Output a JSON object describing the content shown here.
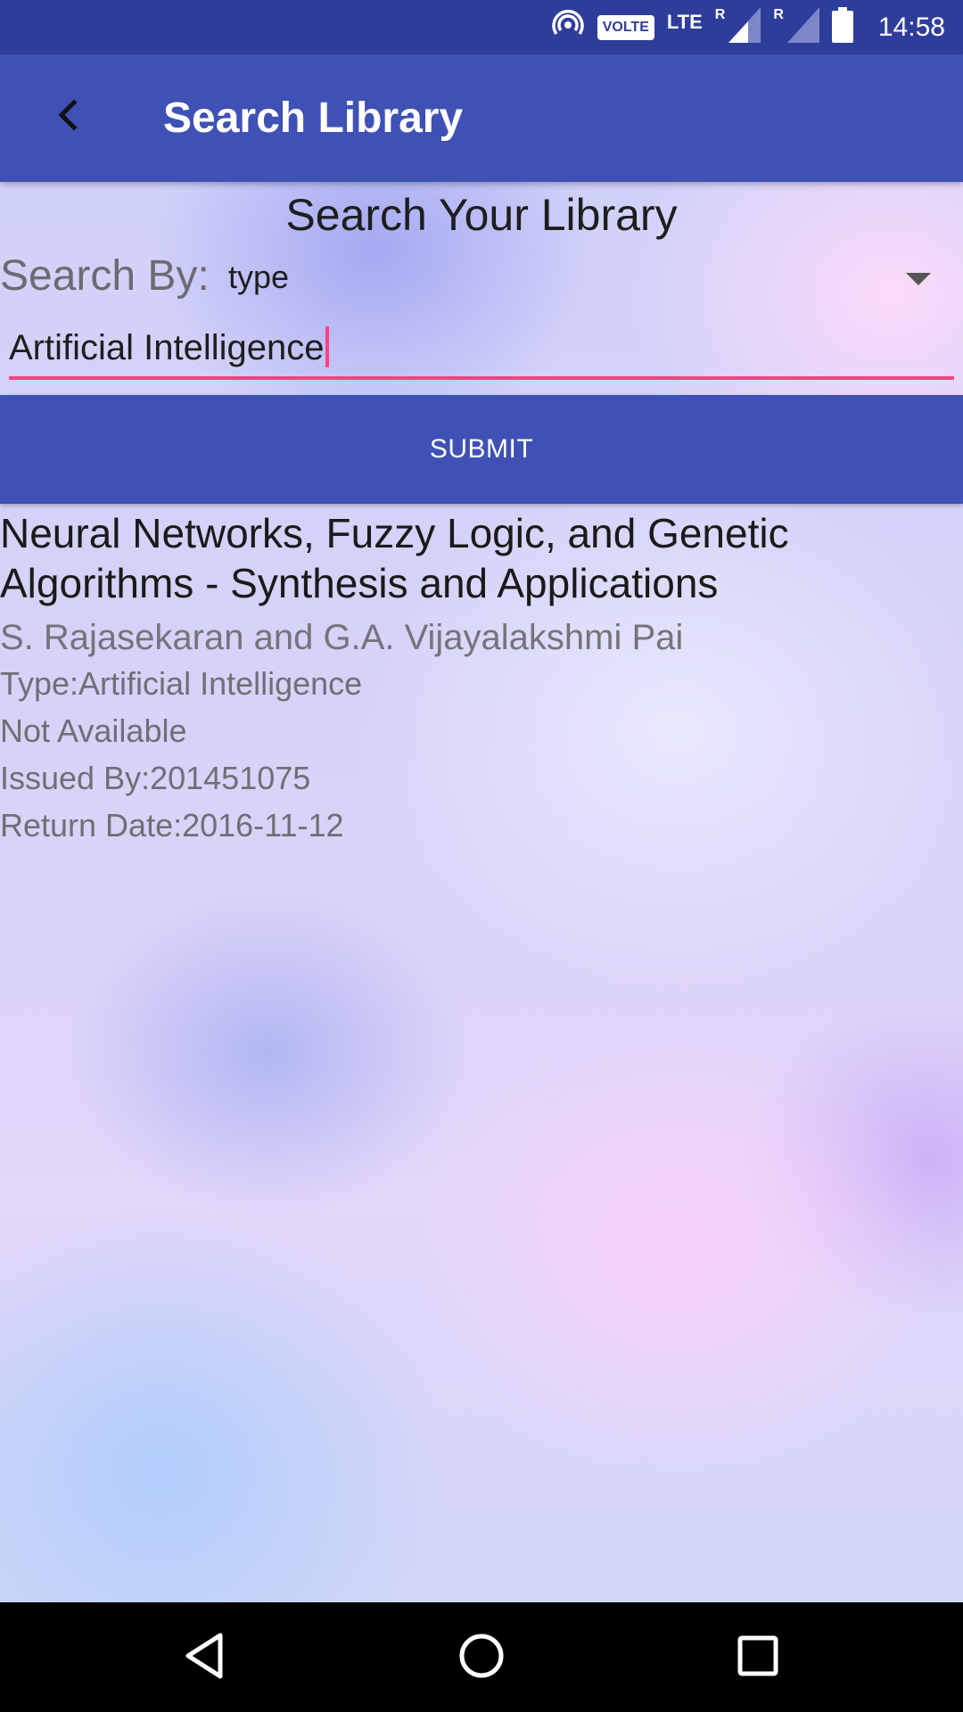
{
  "status_bar": {
    "volte": "VOLTE",
    "lte": "LTE",
    "roaming_1": "R",
    "roaming_2": "R",
    "time": "14:58"
  },
  "app_bar": {
    "title": "Search Library",
    "back_icon": "chevron-left-icon"
  },
  "search": {
    "heading": "Search Your Library",
    "search_by_label": "Search By:",
    "search_by_value": "type",
    "query_value": "Artificial Intelligence",
    "submit_label": "SUBMIT"
  },
  "result": {
    "title": "Neural Networks, Fuzzy Logic, and Genetic Algorithms - Synthesis and Applications",
    "author": "S. Rajasekaran and G.A. Vijayalakshmi Pai",
    "type": "Type:Artificial Intelligence",
    "availability": "Not Available",
    "issued_by": "Issued By:201451075",
    "return_date": "Return Date:2016-11-12"
  },
  "colors": {
    "primary": "#3f51b5",
    "primary_dark": "#2f3d9a",
    "accent": "#ff4081"
  }
}
